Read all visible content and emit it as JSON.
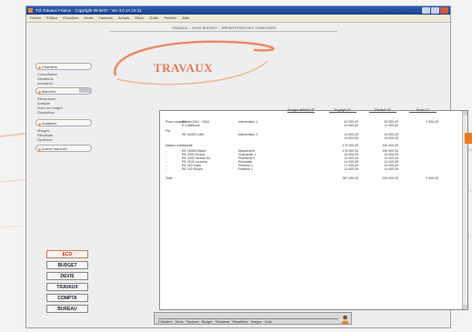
{
  "window": {
    "title": "Trà Travaux France · Copyright 99 BATI · Ver 3.0 1A 10 11"
  },
  "menu": [
    "Fichier",
    "Edition",
    "Chantiers",
    "Devis",
    "Factures",
    "Achats",
    "Stock",
    "Outils",
    "Fenêtre",
    "Aide"
  ],
  "breadcrumb": "TRAVAUX – SUIVI BUDGET – RÉPARTITION DES CHANTIERS",
  "sidebar": {
    "sections": [
      {
        "label": "Chantiers",
        "items": [
          "Consultation",
          "Situations",
          "Avenants"
        ]
      },
      {
        "label": "Marchés",
        "items": [
          "Réceptions",
          "Analyse",
          "Suivi de budget",
          "Répartition"
        ]
      },
      {
        "label": "Analyses",
        "items": [
          "Marges",
          "Résultats",
          "Synthèse"
        ]
      },
      {
        "label": "Autres marchés",
        "items": []
      }
    ],
    "buttons": [
      "ECO",
      "BUDGET",
      "DEVIS",
      "TRAVAUX",
      "COMPTA",
      "BUREAU"
    ]
  },
  "logo": {
    "text": "TRAVAUX",
    "accent": "#e07a5a"
  },
  "report": {
    "columns": [
      "Budget définitif HT",
      "Engagé HT",
      "Réalisé HT",
      "Écart HT"
    ],
    "rows": [
      {
        "label": "Pose complete",
        "ref": "41 Alai 2341 · 2344",
        "sub": "Intervention 1",
        "v": [
          "",
          "42 000,00",
          "33 000,00",
          "2 000,00"
        ]
      },
      {
        "label": "",
        "ref": "R 2 Maisons",
        "sub": "",
        "v": [
          "",
          "13 000,00",
          "11 000,00",
          ""
        ]
      },
      {
        "label": "Fra",
        "ref": "",
        "sub": "",
        "v": [
          "",
          "",
          "",
          ""
        ]
      },
      {
        "label": "",
        "ref": "RE 34000 Cdt9",
        "sub": "Intervention 2",
        "v": [
          "",
          "14 000,00",
          "14 000,00",
          ""
        ]
      },
      {
        "label": "",
        "ref": "",
        "sub": "",
        "v": [
          "",
          "19 000,00",
          "19 000,00",
          ""
        ]
      },
      {
        "label": "Maison individuelle",
        "ref": "",
        "sub": "",
        "v": [
          "",
          "173 000,00",
          "150 000,00",
          ""
        ]
      },
      {
        "label": "-",
        "ref": "RE 15000 Elbeuf",
        "sub": "Maçonnerie",
        "v": [
          "",
          "176 000,00",
          "150 000,00",
          ""
        ]
      },
      {
        "label": "-",
        "ref": "RE 2000 Evreux",
        "sub": "Charpente 1",
        "v": [
          "",
          "16 000,00",
          "15 000,00",
          ""
        ]
      },
      {
        "label": "-",
        "ref": "RE 2400 Vernon S/L",
        "sub": "Plomberie 1",
        "v": [
          "",
          "11 000,00",
          "11 000,00",
          ""
        ]
      },
      {
        "label": "-",
        "ref": "RE 3100 Louviers",
        "sub": "Electricité",
        "v": [
          "",
          "14 000,00",
          "13 000,00",
          ""
        ]
      },
      {
        "label": "-",
        "ref": "RE 320 Caen",
        "sub": "Peinture 1",
        "v": [
          "",
          "17 000,00",
          "13 000,00",
          ""
        ]
      },
      {
        "label": "-",
        "ref": "RE 130 Rouen",
        "sub": "Finitions 1",
        "v": [
          "",
          "12 000,00",
          "14 000,00",
          ""
        ]
      },
      {
        "label": "Total",
        "ref": "",
        "sub": "",
        "v": [
          "",
          "267 000,00",
          "234 000,00",
          "2 000,00"
        ]
      }
    ]
  },
  "status_bar": {
    "text": "Chantiers · Devis · Factures · Budget · Situations · Répartition · Marges · Suivi"
  }
}
